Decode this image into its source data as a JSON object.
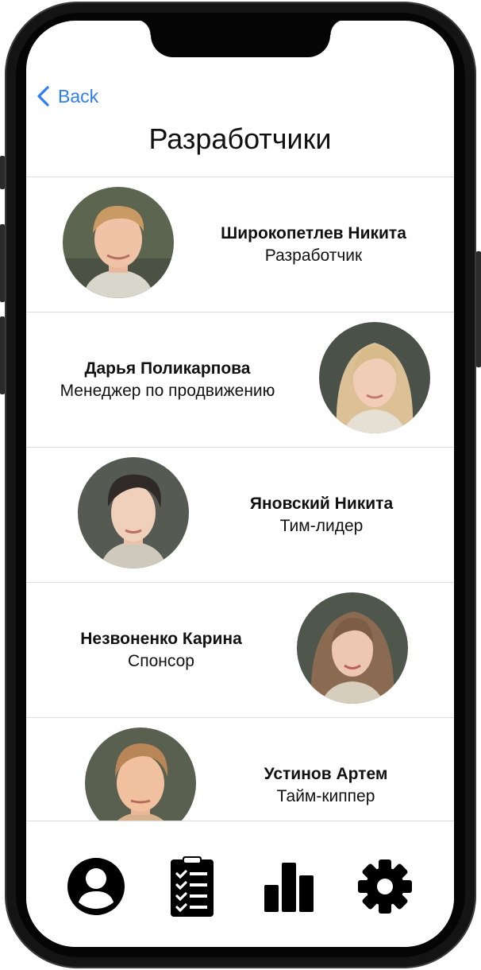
{
  "nav": {
    "back_label": "Back",
    "title": "Разработчики"
  },
  "developers": [
    {
      "name": "Широкопетлев Никита",
      "role": "Разработчик"
    },
    {
      "name": "Дарья Поликарпова",
      "role": "Менеджер по продвижению"
    },
    {
      "name": "Яновский Никита",
      "role": "Тим-лидер"
    },
    {
      "name": "Незвоненко Карина",
      "role": "Спонсор"
    },
    {
      "name": "Устинов Артем",
      "role": "Тайм-киппер"
    }
  ],
  "tabbar": {
    "icons": [
      "profile-icon",
      "clipboard-checklist-icon",
      "bar-chart-icon",
      "gear-icon"
    ]
  },
  "colors": {
    "accent": "#2f7cf6",
    "text": "#111111",
    "divider": "#dcdcdc",
    "frame": "#141414"
  }
}
